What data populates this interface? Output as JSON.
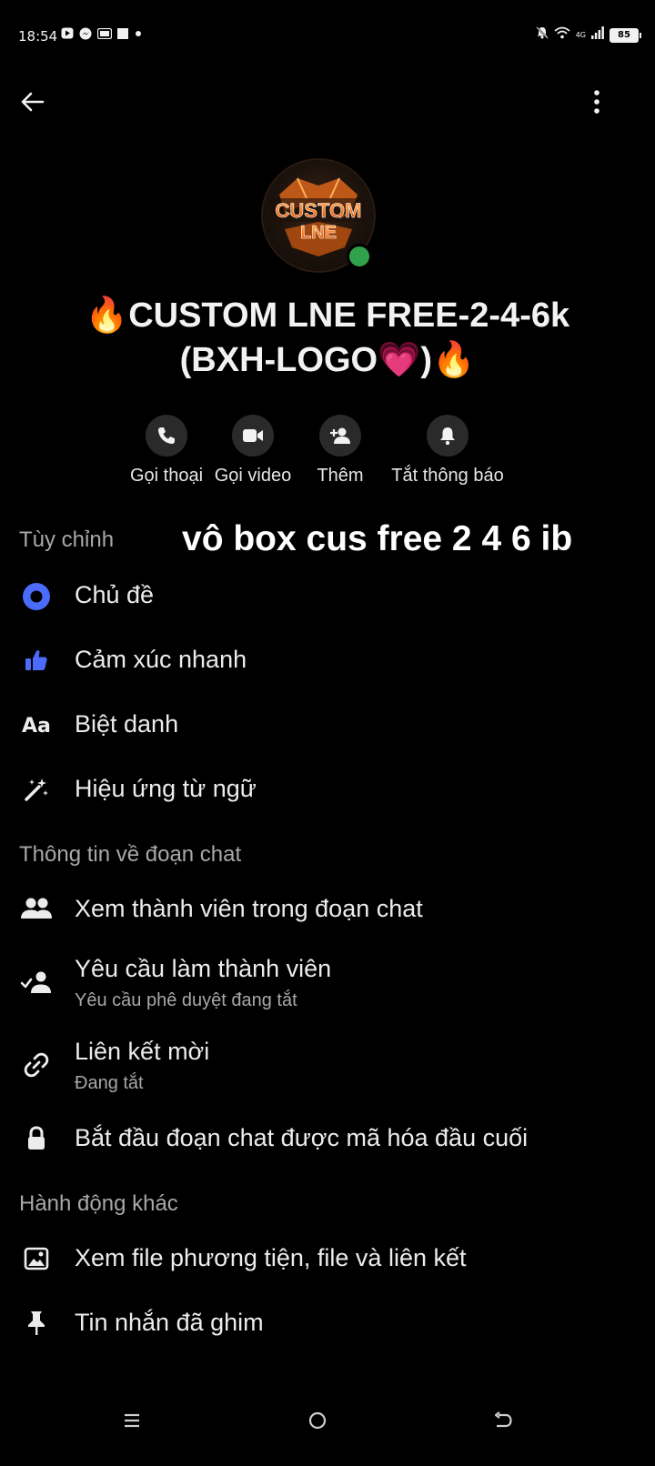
{
  "status_bar": {
    "time": "18:54",
    "network": "4G",
    "battery": "85",
    "left_icons": [
      "video-app-icon",
      "messenger-icon",
      "gallery-icon",
      "stop-icon",
      "dot-icon"
    ],
    "right_icons": [
      "mute-bell-icon",
      "wifi-icon",
      "signal-icon",
      "battery-icon"
    ]
  },
  "header": {
    "back_icon": "arrow-left-icon",
    "more_icon": "vertical-dots-icon"
  },
  "profile": {
    "avatar_text_line1": "CUSTOM",
    "avatar_text_line2": "LNE",
    "online": true,
    "title": "🔥CUSTOM LNE FREE-2-4-6k (BXH-LOGO💗)🔥"
  },
  "actions": [
    {
      "icon": "phone-icon",
      "label": "Gọi thoại"
    },
    {
      "icon": "video-camera-icon",
      "label": "Gọi video"
    },
    {
      "icon": "add-person-icon",
      "label": "Thêm"
    },
    {
      "icon": "bell-icon",
      "label": "Tắt thông báo"
    }
  ],
  "overlay_caption": "vô box cus free 2 4 6 ib",
  "sections": {
    "customize": {
      "header": "Tùy chỉnh",
      "items": [
        {
          "icon": "theme-dot-icon",
          "label": "Chủ đề"
        },
        {
          "icon": "thumbs-up-icon",
          "label": "Cảm xúc nhanh"
        },
        {
          "icon": "text-aa-icon",
          "label": "Biệt danh"
        },
        {
          "icon": "magic-wand-icon",
          "label": "Hiệu ứng từ ngữ"
        }
      ]
    },
    "chat_info": {
      "header": "Thông tin về đoạn chat",
      "items": [
        {
          "icon": "people-icon",
          "label": "Xem thành viên trong đoạn chat",
          "sub": ""
        },
        {
          "icon": "person-check-icon",
          "label": "Yêu cầu làm thành viên",
          "sub": "Yêu cầu phê duyệt đang tắt"
        },
        {
          "icon": "link-icon",
          "label": "Liên kết mời",
          "sub": "Đang tắt"
        },
        {
          "icon": "lock-icon",
          "label": "Bắt đầu đoạn chat được mã hóa đầu cuối",
          "sub": ""
        }
      ]
    },
    "other_actions": {
      "header": "Hành động khác",
      "items": [
        {
          "icon": "image-icon",
          "label": "Xem file phương tiện, file và liên kết"
        },
        {
          "icon": "pin-icon",
          "label": "Tin nhắn đã ghim"
        }
      ]
    }
  },
  "colors": {
    "accent": "#4b6bfb",
    "online": "#31a24c",
    "background": "#000000",
    "secondary_text": "#a8a8a8",
    "action_circle": "#2a2a2a"
  },
  "nav_bar": {
    "icons": [
      "menu-lines-icon",
      "home-circle-icon",
      "back-return-icon"
    ]
  }
}
